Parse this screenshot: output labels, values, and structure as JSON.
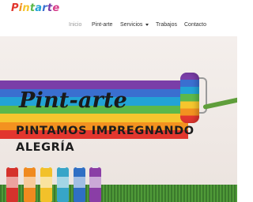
{
  "brand": {
    "logo_letters": [
      {
        "char": "P",
        "color": "#e2362e"
      },
      {
        "char": "i",
        "color": "#f39220"
      },
      {
        "char": "n",
        "color": "#f5c62e"
      },
      {
        "char": "t",
        "color": "#5cb84a"
      },
      {
        "char": "a",
        "color": "#22a3d6"
      },
      {
        "char": "r",
        "color": "#3a6fd0"
      },
      {
        "char": "t",
        "color": "#7a3ea8"
      },
      {
        "char": "e",
        "color": "#d63c8a"
      }
    ]
  },
  "nav": {
    "items": [
      {
        "label": "Inicio",
        "active": true
      },
      {
        "label": "Pint-arte",
        "active": false
      },
      {
        "label": "Servicios",
        "active": false,
        "has_dropdown": true
      },
      {
        "label": "Trabajos",
        "active": false
      },
      {
        "label": "Contacto",
        "active": false
      }
    ]
  },
  "hero": {
    "title": "Pint-arte",
    "subtitle_line1": "PINTAMOS IMPREGNANDO",
    "subtitle_line2": "ALEGRÍA",
    "stripe_colors": [
      "#7a3ea8",
      "#3a6fd0",
      "#22a3d6",
      "#5cb84a",
      "#f5c62e",
      "#f39220",
      "#e2362e"
    ],
    "bottle_colors": [
      "#d5322c",
      "#f08a1f",
      "#f2c12a",
      "#37a5c8",
      "#2f6fc4",
      "#8a3ea6"
    ]
  },
  "colors": {
    "nav_text": "#333333",
    "nav_active": "#9a9a9a",
    "grass": "#4f9a38"
  }
}
